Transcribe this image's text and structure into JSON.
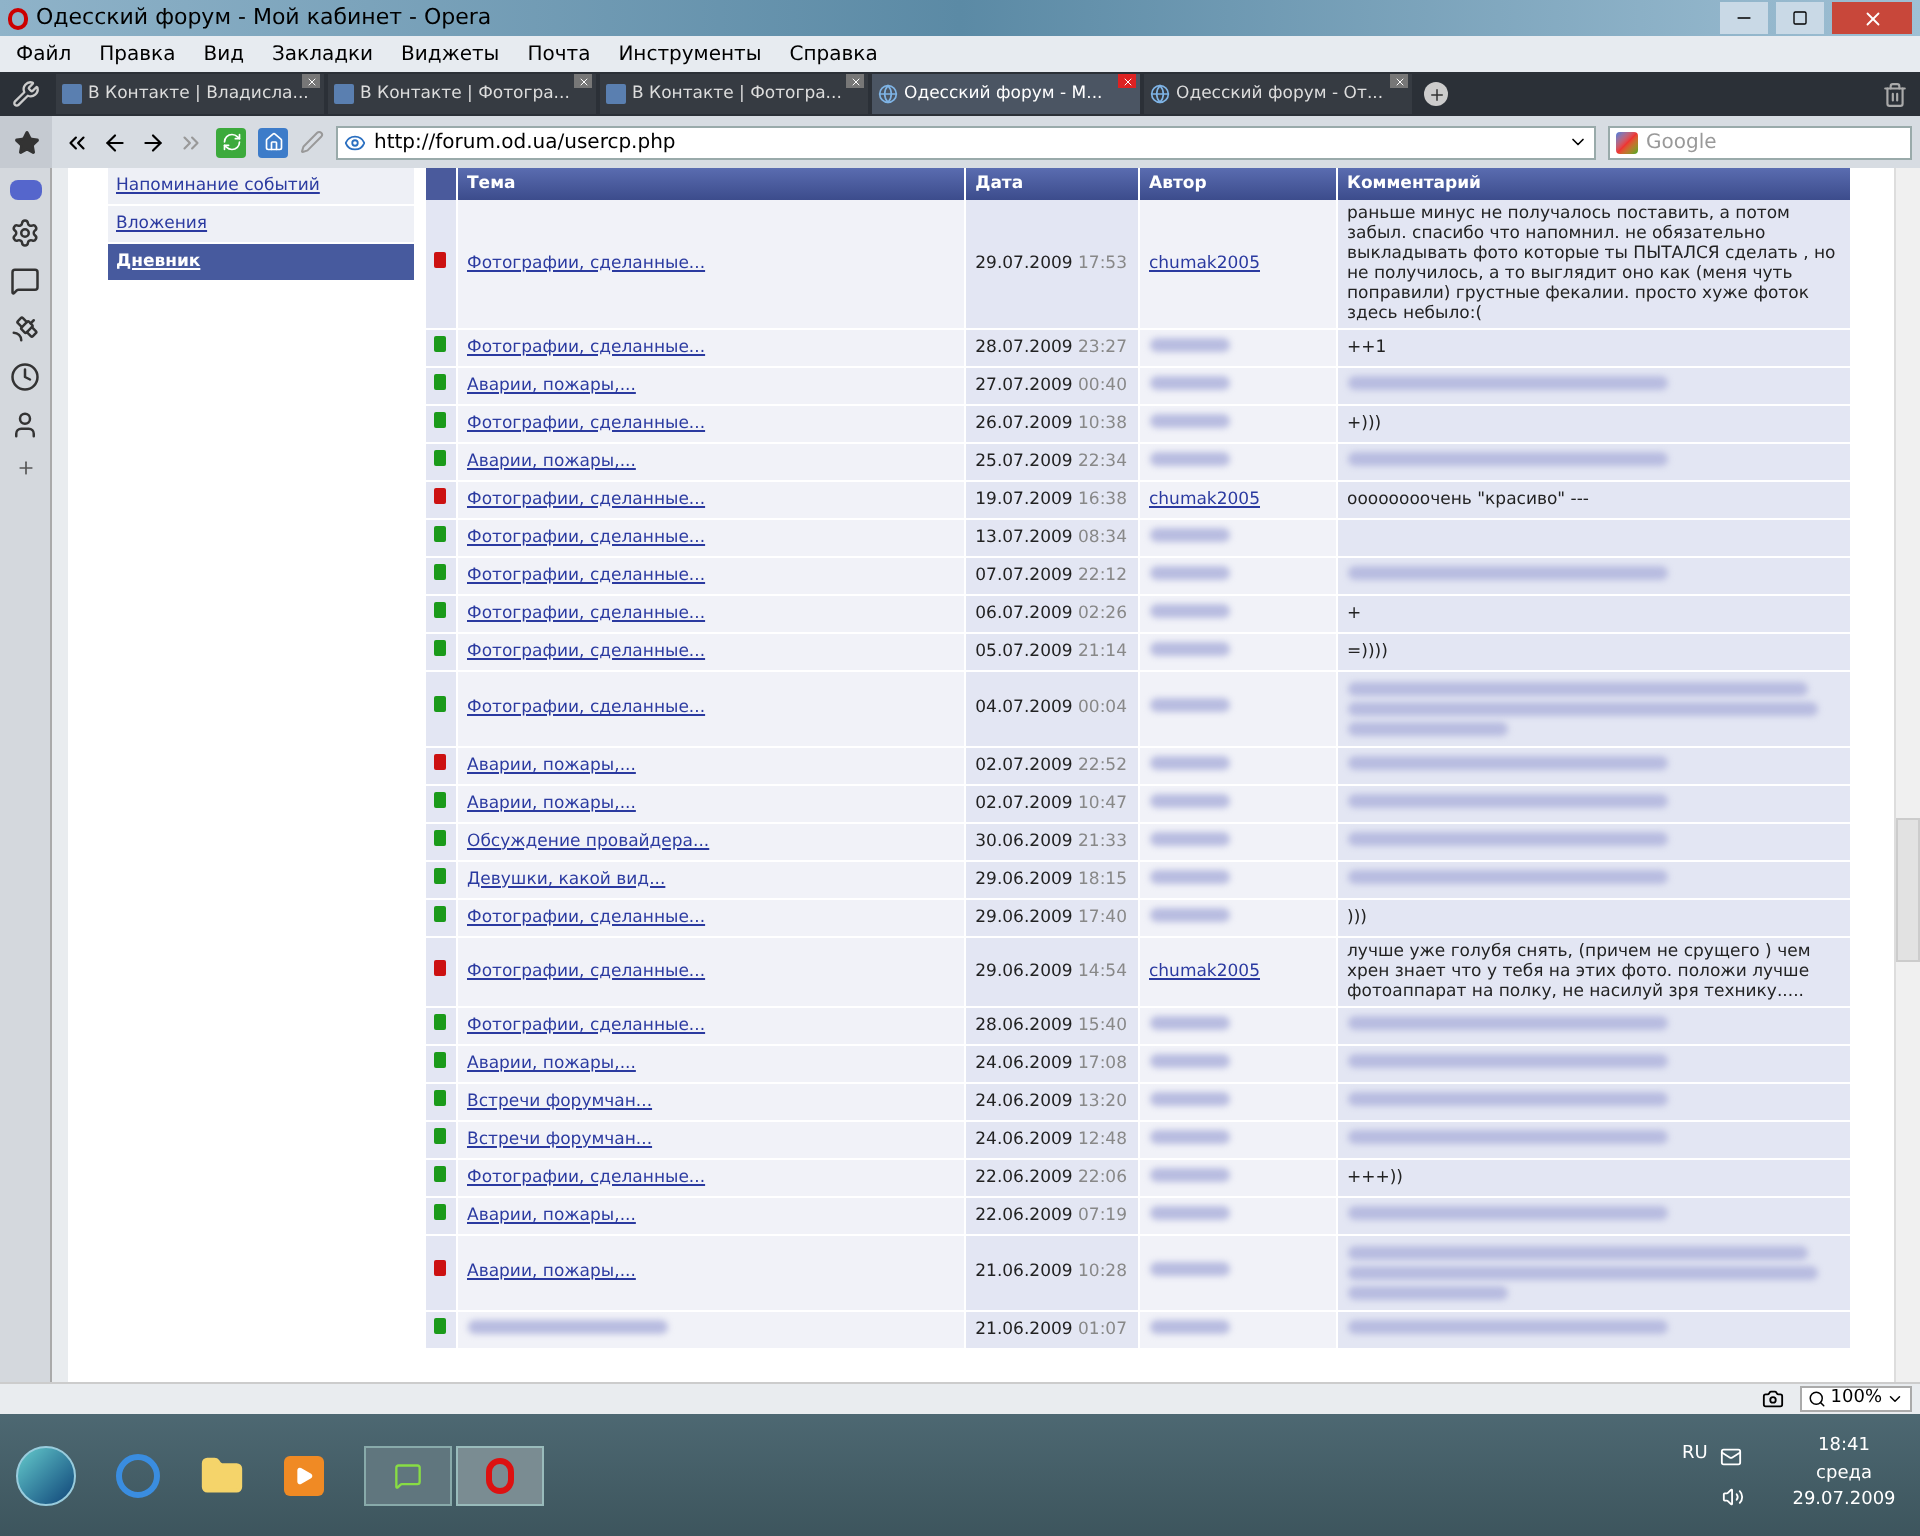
{
  "window": {
    "title": "Одесский форум - Мой кабинет - Opera"
  },
  "menu": [
    "Файл",
    "Правка",
    "Вид",
    "Закладки",
    "Виджеты",
    "Почта",
    "Инструменты",
    "Справка"
  ],
  "tabs": [
    {
      "label": "В Контакте | Владисла...",
      "selected": false,
      "kind": "vk"
    },
    {
      "label": "В Контакте | Фотогра...",
      "selected": false,
      "kind": "vk"
    },
    {
      "label": "В Контакте | Фотогра...",
      "selected": false,
      "kind": "vk"
    },
    {
      "label": "Одесский форум - М...",
      "selected": true,
      "kind": "forum"
    },
    {
      "label": "Одесский форум - От...",
      "selected": false,
      "kind": "forum"
    }
  ],
  "address": {
    "value": "http://forum.od.ua/usercp.php"
  },
  "search": {
    "placeholder": "Google"
  },
  "sidebar": {
    "items": [
      {
        "label": "Напоминание событий",
        "selected": false
      },
      {
        "label": "Вложения",
        "selected": false
      },
      {
        "label": "Дневник",
        "selected": true
      }
    ]
  },
  "table": {
    "columns": [
      "Тема",
      "Дата",
      "Автор",
      "Комментарий"
    ],
    "rows": [
      {
        "color": "#cc1111",
        "topic": "Фотографии, сделанные...",
        "date": "29.07.2009",
        "time": "17:53",
        "author": "chumak2005",
        "comment": "раньше минус не получалось поставить, а потом забыл. спасибо что напомнил. не обязательно выкладывать фото которые ты ПЫТАЛСЯ сделать , но не получилось, а то выглядит оно как (меня чуть поправили) грустные фекалии. просто хуже фоток здесь небыло:("
      },
      {
        "color": "#1a9a1a",
        "topic": "Фотографии, сделанные...",
        "date": "28.07.2009",
        "time": "23:27",
        "author_blurred": true,
        "comment": "++1"
      },
      {
        "color": "#1a9a1a",
        "topic": "Аварии, пожары,...",
        "date": "27.07.2009",
        "time": "00:40",
        "author_blurred": true,
        "comment_blurred": true
      },
      {
        "color": "#1a9a1a",
        "topic": "Фотографии, сделанные...",
        "date": "26.07.2009",
        "time": "10:38",
        "author_blurred": true,
        "comment": "+)))"
      },
      {
        "color": "#1a9a1a",
        "topic": "Аварии, пожары,...",
        "date": "25.07.2009",
        "time": "22:34",
        "author_blurred": true,
        "comment_blurred": true
      },
      {
        "color": "#cc1111",
        "topic": "Фотографии, сделанные...",
        "date": "19.07.2009",
        "time": "16:38",
        "author": "chumak2005",
        "comment": "оооооооочень \"красиво\" ---"
      },
      {
        "color": "#1a9a1a",
        "topic": "Фотографии, сделанные...",
        "date": "13.07.2009",
        "time": "08:34",
        "author_blurred": true
      },
      {
        "color": "#1a9a1a",
        "topic": "Фотографии, сделанные...",
        "date": "07.07.2009",
        "time": "22:12",
        "author_blurred": true,
        "comment_blurred": true
      },
      {
        "color": "#1a9a1a",
        "topic": "Фотографии, сделанные...",
        "date": "06.07.2009",
        "time": "02:26",
        "author_blurred": true,
        "comment": "+"
      },
      {
        "color": "#1a9a1a",
        "topic": "Фотографии, сделанные...",
        "date": "05.07.2009",
        "time": "21:14",
        "author_blurred": true,
        "comment": "=))))"
      },
      {
        "color": "#1a9a1a",
        "topic": "Фотографии, сделанные...",
        "date": "04.07.2009",
        "time": "00:04",
        "author_blurred": true,
        "comment_blurred": true,
        "comment_multiline": true
      },
      {
        "color": "#cc1111",
        "topic": "Аварии, пожары,...",
        "date": "02.07.2009",
        "time": "22:52",
        "author_blurred": true,
        "comment_blurred": true
      },
      {
        "color": "#1a9a1a",
        "topic": "Аварии, пожары,...",
        "date": "02.07.2009",
        "time": "10:47",
        "author_blurred": true,
        "comment_blurred": true
      },
      {
        "color": "#1a9a1a",
        "topic": "Обсуждение провайдера...",
        "date": "30.06.2009",
        "time": "21:33",
        "author_blurred": true,
        "comment_blurred": true
      },
      {
        "color": "#1a9a1a",
        "topic": "Девушки, какой вид...",
        "date": "29.06.2009",
        "time": "18:15",
        "author_blurred": true,
        "comment_blurred": true
      },
      {
        "color": "#1a9a1a",
        "topic": "Фотографии, сделанные...",
        "date": "29.06.2009",
        "time": "17:40",
        "author_blurred": true,
        "comment": ")))"
      },
      {
        "color": "#cc1111",
        "topic": "Фотографии, сделанные...",
        "date": "29.06.2009",
        "time": "14:54",
        "author": "chumak2005",
        "comment": "лучше уже голубя снять, (причем не срущего ) чем хрен знает что у тебя на этих фото. положи лучше фотоаппарат на полку, не насилуй зря технику....."
      },
      {
        "color": "#1a9a1a",
        "topic": "Фотографии, сделанные...",
        "date": "28.06.2009",
        "time": "15:40",
        "author_blurred": true,
        "comment_blurred": true
      },
      {
        "color": "#1a9a1a",
        "topic": "Аварии, пожары,...",
        "date": "24.06.2009",
        "time": "17:08",
        "author_blurred": true,
        "comment_blurred": true
      },
      {
        "color": "#1a9a1a",
        "topic": "Встречи форумчан...",
        "date": "24.06.2009",
        "time": "13:20",
        "author_blurred": true,
        "comment_blurred": true
      },
      {
        "color": "#1a9a1a",
        "topic": "Встречи форумчан...",
        "date": "24.06.2009",
        "time": "12:48",
        "author_blurred": true,
        "comment_blurred": true
      },
      {
        "color": "#1a9a1a",
        "topic": "Фотографии, сделанные...",
        "date": "22.06.2009",
        "time": "22:06",
        "author_blurred": true,
        "comment": "+++))"
      },
      {
        "color": "#1a9a1a",
        "topic": "Аварии, пожары,...",
        "date": "22.06.2009",
        "time": "07:19",
        "author_blurred": true,
        "comment_blurred": true
      },
      {
        "color": "#cc1111",
        "topic": "Аварии, пожары,...",
        "date": "21.06.2009",
        "time": "10:28",
        "author_blurred": true,
        "comment_blurred": true,
        "comment_multiline": true
      },
      {
        "color": "#1a9a1a",
        "topic_blurred": true,
        "date": "21.06.2009",
        "time": "01:07",
        "author_blurred": true,
        "comment_blurred": true
      }
    ]
  },
  "status_bar": {
    "zoom": "100%"
  },
  "taskbar": {
    "language": "RU",
    "time": "18:41",
    "day": "среда",
    "date": "29.07.2009"
  }
}
